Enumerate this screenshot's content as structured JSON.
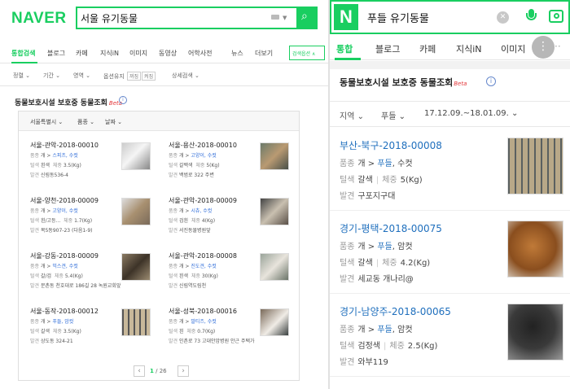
{
  "colors": {
    "naver_green": "#19ce60",
    "link_blue": "#1f6fbd",
    "beta_red": "#e3393c"
  },
  "desktop": {
    "logo": "NAVER",
    "query": "서울 유기동물",
    "tabs": [
      "통합검색",
      "블로그",
      "카페",
      "지식iN",
      "이미지",
      "동영상",
      "어학사전",
      "뉴스",
      "더보기"
    ],
    "search_options": "검색옵션",
    "filters": [
      "정렬",
      "기간",
      "영역",
      "옵션유지",
      "꺼짐",
      "켜짐",
      "상세검색"
    ],
    "section_title": "동물보호시설 보호중 동물조회",
    "beta": "Beta",
    "dropdowns": [
      "서울특별시",
      "품종",
      "날짜"
    ],
    "labels": {
      "breed": "품종",
      "color": "털색",
      "weight": "체중",
      "found": "발견"
    },
    "cards": [
      {
        "title": "서울-관악-2018-00010",
        "breed": "개",
        "breed_name": "스피츠, 수컷",
        "color": "흰색",
        "weight": "3.5(Kg)",
        "found": "신림동536-4"
      },
      {
        "title": "서울-용산-2018-00010",
        "breed": "개",
        "breed_name": "고양이, 수컷",
        "color": "갈백색",
        "weight": "5(Kg)",
        "found": "백범로 322 주변"
      },
      {
        "title": "서울-양천-2018-00009",
        "breed": "개",
        "breed_name": "고양이, 수컷",
        "color": "흰/고등...",
        "weight": "1.7(Kg)",
        "found": "목5동907-23 (다음1-9)"
      },
      {
        "title": "서울-관악-2018-00009",
        "breed": "개",
        "breed_name": "시츄, 수컷",
        "color": "검흰",
        "weight": "4(Kg)",
        "found": "서진동물병원앞"
      },
      {
        "title": "서울-강동-2018-00009",
        "breed": "개",
        "breed_name": "믹스견, 수컷",
        "color": "갈/검",
        "weight": "5.4(Kg)",
        "found": "문촌동 천호대로 186길 28 녹원교회앞"
      },
      {
        "title": "서울-관악-2018-00008",
        "breed": "개",
        "breed_name": "진도견, 수컷",
        "color": "흰색",
        "weight": "30(Kg)",
        "found": "신림역도림천"
      },
      {
        "title": "서울-동작-2018-00012",
        "breed": "개",
        "breed_name": "푸들, 암컷",
        "color": "갈색",
        "weight": "3.5(Kg)",
        "found": "상도동 324-21"
      },
      {
        "title": "서울-성북-2018-00016",
        "breed": "개",
        "breed_name": "말티즈, 수컷",
        "color": "흰",
        "weight": "0.7(Kg)",
        "found": "인촌로 73 고대안암병원 안근 주택가"
      }
    ],
    "pager": {
      "current": "1",
      "total": "/ 26"
    }
  },
  "mobile": {
    "logo": "N",
    "query": "푸들 유기동물",
    "tabs": [
      "통합",
      "블로그",
      "카페",
      "지식iN",
      "이미지"
    ],
    "section_title": "동물보호시설 보호중 동물조회",
    "beta": "Beta",
    "filters": {
      "region": "지역",
      "breed": "푸들",
      "date_range": "17.12.09.~18.01.09."
    },
    "labels": {
      "breed": "품종",
      "color": "털색",
      "weight": "체중",
      "found": "발견"
    },
    "cards": [
      {
        "title": "부산-북구-2018-00008",
        "breed": "개",
        "breed_name": "푸들",
        "sex": "수컷",
        "color": "갈색",
        "weight": "5(Kg)",
        "found": "구포지구대"
      },
      {
        "title": "경기-평택-2018-00075",
        "breed": "개",
        "breed_name": "푸들",
        "sex": "암컷",
        "color": "갈색",
        "weight": "4.2(Kg)",
        "found": "세교동 개나리@"
      },
      {
        "title": "경기-남양주-2018-00065",
        "breed": "개",
        "breed_name": "푸들",
        "sex": "암컷",
        "color": "검정색",
        "weight": "2.5(Kg)",
        "found": "와부119"
      }
    ]
  }
}
